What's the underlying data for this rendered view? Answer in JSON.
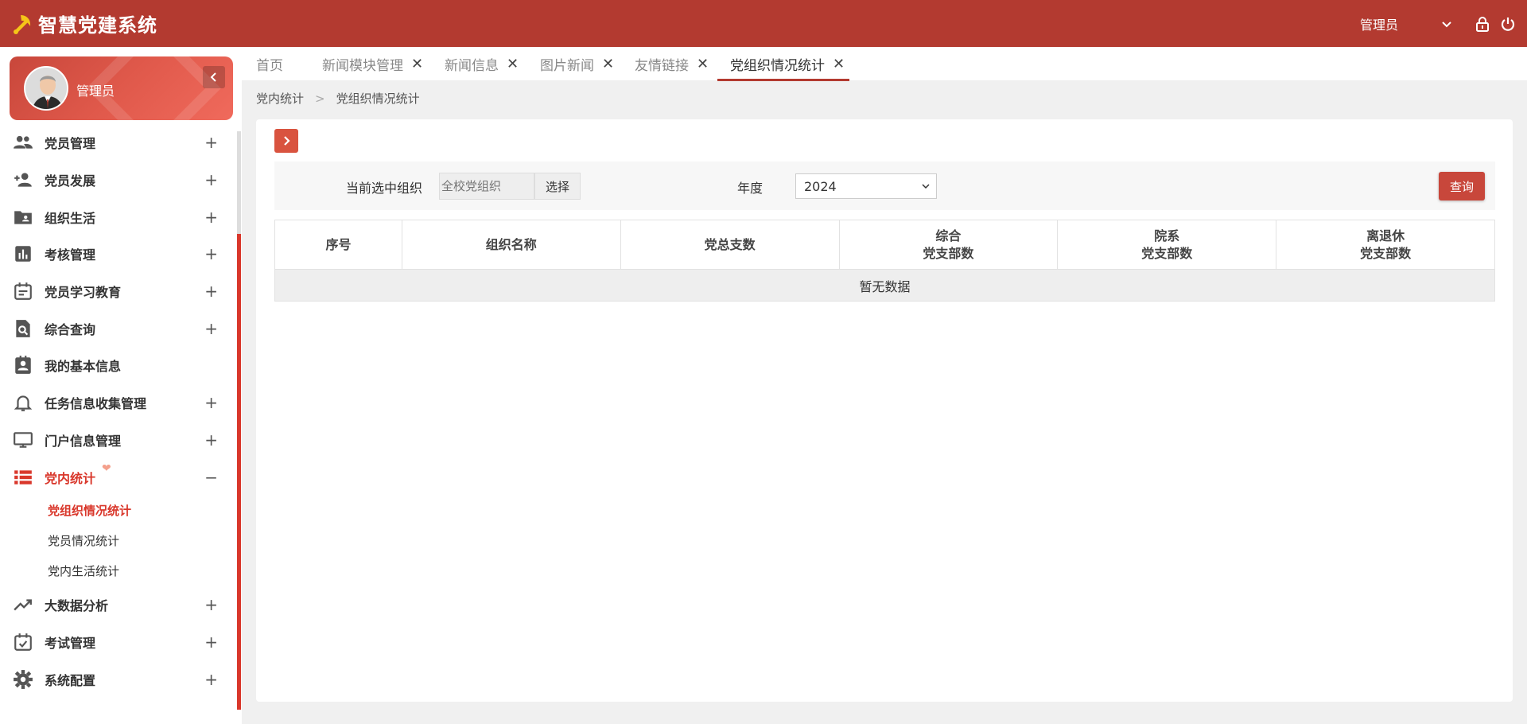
{
  "app": {
    "title": "智慧党建系统",
    "user": "管理员"
  },
  "profile": {
    "name": "管理员"
  },
  "sidebar": {
    "items": [
      {
        "label": "党员管理",
        "icon": "people-icon",
        "expander": "+"
      },
      {
        "label": "党员发展",
        "icon": "person-add-icon",
        "expander": "+"
      },
      {
        "label": "组织生活",
        "icon": "folder-user-icon",
        "expander": "+"
      },
      {
        "label": "考核管理",
        "icon": "bar-chart-icon",
        "expander": "+"
      },
      {
        "label": "党员学习教育",
        "icon": "calendar-note-icon",
        "expander": "+"
      },
      {
        "label": "综合查询",
        "icon": "search-doc-icon",
        "expander": "+"
      },
      {
        "label": "我的基本信息",
        "icon": "contact-card-icon",
        "expander": ""
      },
      {
        "label": "任务信息收集管理",
        "icon": "bell-icon",
        "expander": "+"
      },
      {
        "label": "门户信息管理",
        "icon": "monitor-icon",
        "expander": "+"
      },
      {
        "label": "党内统计",
        "icon": "list-icon",
        "expander": "−"
      }
    ],
    "subitems": [
      "党组织情况统计",
      "党员情况统计",
      "党内生活统计"
    ],
    "items_after": [
      {
        "label": "大数据分析",
        "icon": "trending-up-icon",
        "expander": "+"
      },
      {
        "label": "考试管理",
        "icon": "calendar-check-icon",
        "expander": "+"
      },
      {
        "label": "系统配置",
        "icon": "gear-icon",
        "expander": "+"
      }
    ]
  },
  "tabs": [
    {
      "label": "首页"
    },
    {
      "label": "新闻模块管理"
    },
    {
      "label": "新闻信息"
    },
    {
      "label": "图片新闻"
    },
    {
      "label": "友情链接"
    },
    {
      "label": "党组织情况统计"
    }
  ],
  "tab_close": "✕",
  "breadcrumb": {
    "parent": "党内统计",
    "separator": ">",
    "current": "党组织情况统计"
  },
  "filter": {
    "org_label": "当前选中组织",
    "org_placeholder": "全校党组织",
    "select_button": "选择",
    "year_label": "年度",
    "year_value": "2024",
    "query_button": "查询"
  },
  "table": {
    "headers": [
      {
        "line1": "序号",
        "line2": ""
      },
      {
        "line1": "组织名称",
        "line2": ""
      },
      {
        "line1": "党总支数",
        "line2": ""
      },
      {
        "line1": "综合",
        "line2": "党支部数"
      },
      {
        "line1": "院系",
        "line2": "党支部数"
      },
      {
        "line1": "离退休",
        "line2": "党支部数"
      }
    ],
    "empty_text": "暂无数据"
  },
  "colors": {
    "brand": "#b33a30",
    "accent": "#d9372b",
    "button": "#c8473b"
  }
}
